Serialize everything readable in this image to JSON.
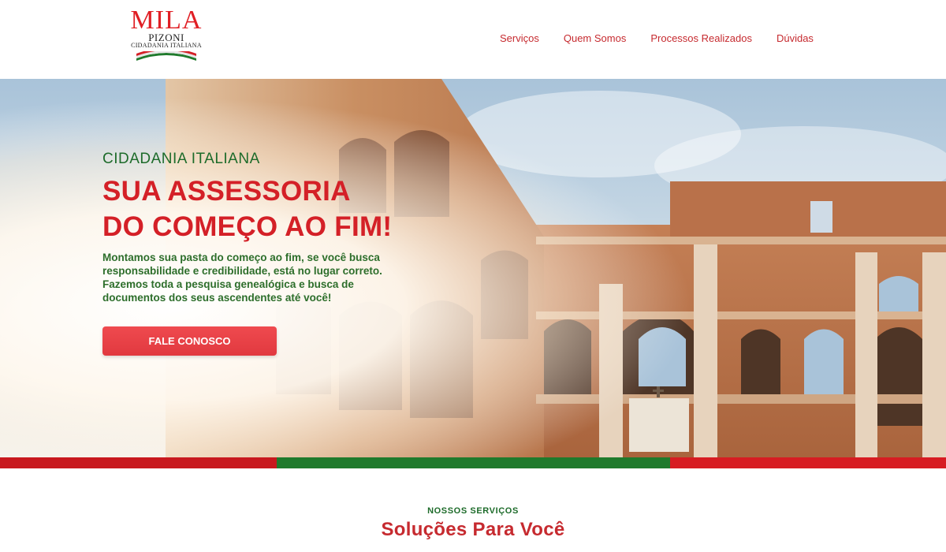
{
  "header": {
    "logo": {
      "main": "MILA",
      "sub": "PIZONI",
      "tag": "CIDADANIA ITALIANA"
    },
    "nav": [
      {
        "label": "Serviços"
      },
      {
        "label": "Quem Somos"
      },
      {
        "label": "Processos Realizados"
      },
      {
        "label": "Dúvidas"
      }
    ]
  },
  "hero": {
    "kicker": "CIDADANIA ITALIANA",
    "headline_line1": "SUA ASSESSORIA",
    "headline_line2": "DO COMEÇO AO FIM!",
    "lead": "Montamos sua pasta do começo ao fim, se você busca responsabilidade e credibilidade, está no lugar correto. Fazemos toda a pesquisa genealógica e busca de documentos dos seus ascendentes até você!",
    "cta_label": "FALE CONOSCO",
    "background": "colosseum-photo"
  },
  "colors": {
    "brand_red": "#d42027",
    "brand_green": "#1d6b2a",
    "stripe_red": "#c8181e",
    "stripe_green": "#1f7a2c"
  },
  "services": {
    "kicker": "NOSSOS SERVIÇOS",
    "title": "Soluções Para Você"
  }
}
